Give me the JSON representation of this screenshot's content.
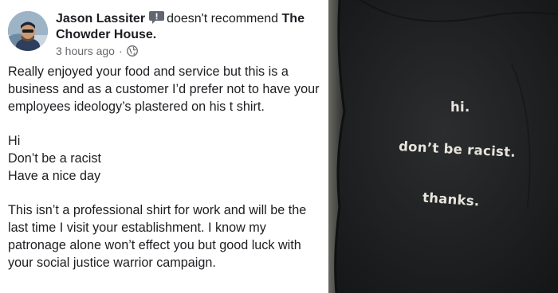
{
  "review": {
    "author": "Jason Lassiter",
    "action": "doesn't recommend",
    "page_name": "The Chowder House.",
    "time": "3 hours ago",
    "paragraph1": "Really enjoyed your food and service but this is a business and as a customer I’d prefer not to have your employees ideology’s plastered on his t shirt.",
    "lines2": [
      "Hi",
      "Don’t be a racist",
      "Have a nice day"
    ],
    "paragraph3": "This isn’t a professional shirt for work and will be the last time I visit your establishment. I know my patronage alone won’t effect you but good luck with your social justice warrior campaign."
  },
  "photo": {
    "line1": "hi.",
    "line2": "don’t be racist.",
    "line3": "thanks."
  },
  "colors": {
    "meta_gray": "#65676b",
    "text": "#1c1e21",
    "shirt": "#1d1f21",
    "shirt_print": "#e7e4dc"
  },
  "icons": [
    "recommendation-icon",
    "globe-icon"
  ]
}
